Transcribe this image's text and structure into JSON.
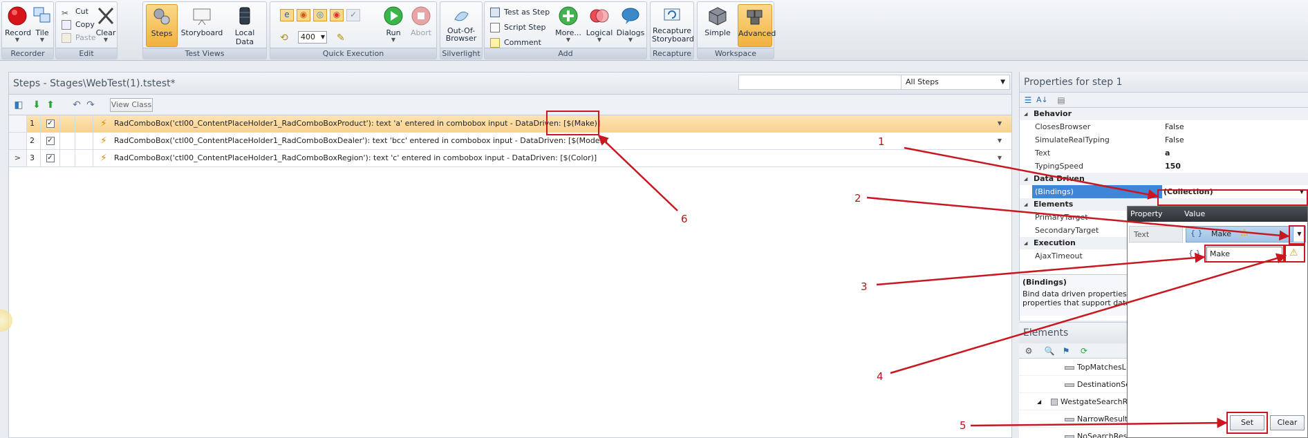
{
  "ribbon": {
    "groups": [
      {
        "label": "Recorder"
      },
      {
        "label": "Edit"
      },
      {
        "label": "Test Views"
      },
      {
        "label": "Quick Execution"
      },
      {
        "label": "Silverlight"
      },
      {
        "label": "Add"
      },
      {
        "label": "Recapture"
      },
      {
        "label": "Workspace"
      }
    ],
    "record": "Record",
    "tile": "Tile",
    "cut": "Cut",
    "copy": "Copy",
    "paste": "Paste",
    "clear": "Clear",
    "steps": "Steps",
    "storyboard": "Storyboard",
    "local_data": "Local Data",
    "speed": "400",
    "run": "Run",
    "abort": "Abort",
    "oob": "Out-Of-Browser",
    "test_as_step": "Test as Step",
    "script_step": "Script Step",
    "comment": "Comment",
    "more": "More...",
    "logical": "Logical",
    "dialogs": "Dialogs",
    "recapture_storyboard": "Recapture Storyboard",
    "simple": "Simple",
    "advanced": "Advanced"
  },
  "steps_panel": {
    "title": "Steps - Stages\\WebTest(1).tstest*",
    "filter": "All Steps",
    "view_class": "View Class",
    "rows": [
      {
        "num": "1",
        "text": "RadComboBox('ctl00_ContentPlaceHolder1_RadComboBoxProduct'): text 'a' entered in combobox input - DataDriven: [$(Make)]"
      },
      {
        "num": "2",
        "text": "RadComboBox('ctl00_ContentPlaceHolder1_RadComboBoxDealer'): text 'bcc' entered in combobox input - DataDriven: [$(Model)]"
      },
      {
        "num": "3",
        "handle": ">",
        "text": "RadComboBox('ctl00_ContentPlaceHolder1_RadComboBoxRegion'): text 'c' entered in combobox input - DataDriven: [$(Color)]"
      }
    ]
  },
  "properties": {
    "title": "Properties for step 1",
    "cat_behavior": "Behavior",
    "closes_browser": "ClosesBrowser",
    "closes_browser_val": "False",
    "simulate": "SimulateRealTyping",
    "simulate_val": "False",
    "text": "Text",
    "text_val": "a",
    "typing_speed": "TypingSpeed",
    "typing_speed_val": "150",
    "cat_data_driven": "Data Driven",
    "bindings": "(Bindings)",
    "bindings_val": "(Collection)",
    "cat_elements": "Elements",
    "primary": "PrimaryTarget",
    "secondary": "SecondaryTarget",
    "cat_execution": "Execution",
    "ajax": "AjaxTimeout",
    "desc_title": "(Bindings)",
    "desc_line1": "Bind data driven properties a",
    "desc_line2": "properties that support data"
  },
  "elements": {
    "title": "Elements",
    "items": [
      "TopMatchesL",
      "DestinationSe",
      "WestgateSearchR",
      "NarrowResult",
      "NoSearchResults"
    ]
  },
  "popup": {
    "col_property": "Property",
    "col_value": "Value",
    "row_name": "Text",
    "row_value": "Make",
    "option": "Make",
    "set": "Set",
    "clear": "Clear"
  },
  "annotations": [
    "1",
    "2",
    "3",
    "4",
    "5",
    "6"
  ],
  "colors": {
    "accent": "#f2b13f",
    "annotation": "#c8171e",
    "selection": "#3f86d8"
  }
}
